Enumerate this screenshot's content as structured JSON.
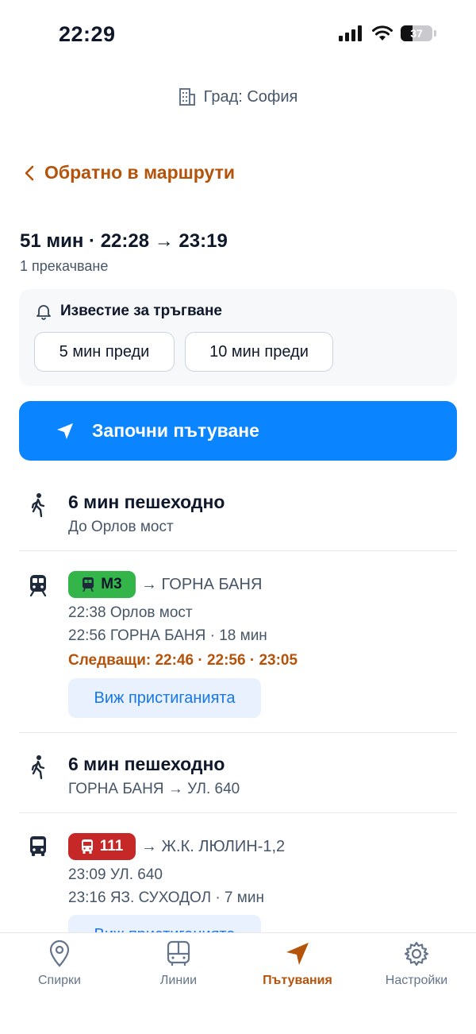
{
  "status_bar": {
    "time": "22:29",
    "battery": "37"
  },
  "header": {
    "city_label": "Град: София"
  },
  "nav": {
    "back_label": "Обратно в маршрути"
  },
  "summary": {
    "title": "51 мин · 22:28 → 23:19",
    "transfers": "1 прекачване"
  },
  "notification": {
    "title": "Известие за тръгване",
    "options": [
      "5 мин преди",
      "10 мин преди"
    ]
  },
  "start_button": {
    "label": "Започни пътуване"
  },
  "legs": {
    "walk1": {
      "title": "6 мин пешеходно",
      "subtitle": "До Орлов мост"
    },
    "metro": {
      "line": "M3",
      "destination": "→ ГОРНА БАНЯ",
      "depart": "22:38 Орлов мост",
      "arrive": "22:56 ГОРНА БАНЯ · 18 мин",
      "next": "Следващи: 22:46 · 22:56 · 23:05",
      "arrivals_button": "Виж пристиганията",
      "color": "#34b54a"
    },
    "walk2": {
      "title": "6 мин пешеходно",
      "subtitle": "ГОРНА БАНЯ → УЛ. 640"
    },
    "bus": {
      "line": "111",
      "destination": "→ Ж.К. ЛЮЛИН-1,2",
      "depart": "23:09 УЛ. 640",
      "arrive": "23:16 ЯЗ. СУХОДОЛ · 7 мин",
      "arrivals_button": "Виж пристиганията",
      "color": "#c62828"
    }
  },
  "tabs": [
    {
      "label": "Спирки",
      "icon": "map-pin-icon"
    },
    {
      "label": "Линии",
      "icon": "bus-icon"
    },
    {
      "label": "Пътувания",
      "icon": "navigation-arrow-icon",
      "active": true
    },
    {
      "label": "Настройки",
      "icon": "gear-icon"
    }
  ],
  "colors": {
    "accent": "#b45309",
    "primary": "#0a84ff"
  }
}
